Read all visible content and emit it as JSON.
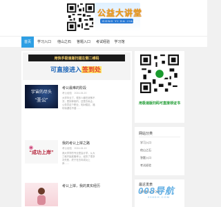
{
  "header": {
    "site_title": "公益大讲堂",
    "site_subtitle": "GONG YI DA JIANG TANG"
  },
  "nav": {
    "items": [
      {
        "label": "首页",
        "active": true
      },
      {
        "label": "学习入口",
        "active": false
      },
      {
        "label": "他山之石",
        "active": false
      },
      {
        "label": "答题入口",
        "active": false
      },
      {
        "label": "考试经验",
        "active": false
      },
      {
        "label": "学习馆",
        "active": false
      }
    ]
  },
  "banner": {
    "top_text": "用快手极速版扫描左侧二维码",
    "main_text": "可直接进入",
    "highlight_text": "签到处"
  },
  "articles": [
    {
      "thumb_text": "“圣公”",
      "thumb_top": "宇宙的尽头",
      "title": "考公最难的阶段",
      "meta": "考公经验　2024-06-20",
      "body": "大学毕业了，很多人都在犹豫不决，是到体制内，还是去私企。公务员这个职业，相对稳定，福利待遇也不错……"
    },
    {
      "thumb_text": "“成功上岸”",
      "thumb_top": "",
      "title": "我的考公上岸之路",
      "meta": "考公经验　2024-06-19",
      "body": "我大学学的专业是会计学，从大三就开始准备考公，经历了很多次失败，终于在去年成功上岸……"
    },
    {
      "thumb_text": "",
      "thumb_top": "",
      "title": "考公上岸，我的真实经历",
      "meta": "",
      "body": ""
    }
  ],
  "side": {
    "qr_caption": "用极速版扫码可直接领证书",
    "category_title": "网站分类",
    "categories": [
      "学习入口",
      "他山之石",
      "答题入口",
      "考试经验"
    ],
    "recent_title": "最近发表",
    "recent_item": "我的考公上岸之路"
  },
  "watermark": {
    "text": "008导航",
    "sub": "008DH.COM"
  },
  "colors": {
    "accent": "#2e9fe4",
    "qr_caption": "#1a9a2e",
    "banner_blue": "#1e66b8",
    "banner_red": "#e23b2f"
  }
}
